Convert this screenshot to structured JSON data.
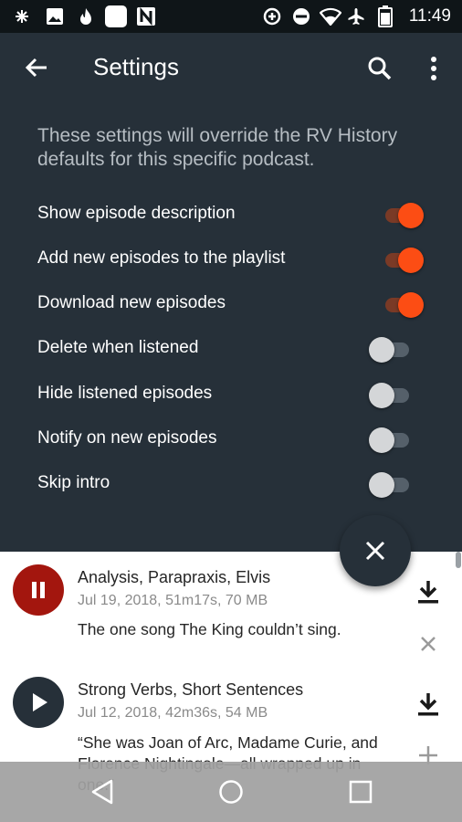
{
  "status_bar": {
    "time": "11:49",
    "icons": [
      "tools-icon",
      "image-icon",
      "flame-icon",
      "white-square-icon",
      "n-logo-icon",
      "data-saver-icon",
      "do-not-disturb-icon",
      "wifi-icon",
      "airplane-icon",
      "battery-icon"
    ]
  },
  "app_bar": {
    "title": "Settings",
    "back_icon": "arrow-back-icon",
    "search_icon": "search-icon",
    "menu_icon": "more-vert-icon"
  },
  "intro_text": "These settings will override the RV History defaults for this specific podcast.",
  "settings": [
    {
      "label": "Show episode description",
      "on": true
    },
    {
      "label": "Add new episodes to the playlist",
      "on": true
    },
    {
      "label": "Download new episodes",
      "on": true
    },
    {
      "label": "Delete when listened",
      "on": false
    },
    {
      "label": "Hide listened episodes",
      "on": false
    },
    {
      "label": "Notify on new episodes",
      "on": false
    },
    {
      "label": "Skip intro",
      "on": false
    }
  ],
  "fab_icon": "close-icon",
  "episodes": [
    {
      "title": "Analysis, Parapraxis, Elvis",
      "meta": "Jul 19, 2018, 51m17s, 70 MB",
      "description": "The one song The King couldn’t sing.",
      "state": "playing",
      "state_icon": "pause-icon",
      "button_color": "#a3160e",
      "action_icon": "remove-x-icon"
    },
    {
      "title": "Strong Verbs, Short Sentences",
      "meta": "Jul 12, 2018, 42m36s, 54 MB",
      "description": "“She was Joan of Arc, Madame Curie, and Florence Nightingale—all wrapped up in one.”",
      "state": "paused",
      "state_icon": "play-icon",
      "button_color": "#263039",
      "action_icon": "add-plus-icon"
    }
  ],
  "colors": {
    "panel": "#263039",
    "accent": "#fc4d14",
    "status_bar": "#0f1518",
    "nav_bar": "#a0a0a0"
  },
  "nav_bar": {
    "buttons": [
      "back-triangle-icon",
      "home-circle-icon",
      "recents-square-icon"
    ]
  }
}
